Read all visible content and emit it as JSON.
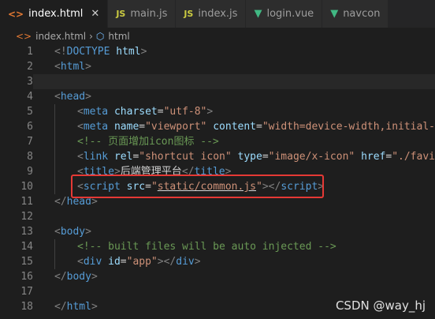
{
  "tabs": [
    {
      "label": "index.html",
      "icon": "html-file-icon",
      "active": true,
      "close": "✕"
    },
    {
      "label": "main.js",
      "icon": "js-file-icon",
      "badge": "JS"
    },
    {
      "label": "index.js",
      "icon": "js-file-icon",
      "badge": "JS"
    },
    {
      "label": "login.vue",
      "icon": "vue-file-icon"
    },
    {
      "label": "navcon",
      "icon": "vue-file-icon"
    }
  ],
  "breadcrumb": {
    "file": "index.html",
    "node": "html"
  },
  "lines": [
    {
      "num": "1",
      "parts": [
        [
          "br",
          "<!"
        ],
        [
          "tag",
          "DOCTYPE"
        ],
        [
          "txt",
          " "
        ],
        [
          "attr",
          "html"
        ],
        [
          "br",
          ">"
        ]
      ]
    },
    {
      "num": "2",
      "parts": [
        [
          "br",
          "<"
        ],
        [
          "tag",
          "html"
        ],
        [
          "br",
          ">"
        ]
      ]
    },
    {
      "num": "3",
      "parts": [],
      "current": true
    },
    {
      "num": "4",
      "parts": [
        [
          "br",
          "<"
        ],
        [
          "tag",
          "head"
        ],
        [
          "br",
          ">"
        ]
      ]
    },
    {
      "num": "5",
      "indent": 1,
      "parts": [
        [
          "br",
          "<"
        ],
        [
          "tag",
          "meta"
        ],
        [
          "txt",
          " "
        ],
        [
          "attr",
          "charset"
        ],
        [
          "txt",
          "="
        ],
        [
          "str",
          "\"utf-8\""
        ],
        [
          "br",
          ">"
        ]
      ]
    },
    {
      "num": "6",
      "indent": 1,
      "parts": [
        [
          "br",
          "<"
        ],
        [
          "tag",
          "meta"
        ],
        [
          "txt",
          " "
        ],
        [
          "attr",
          "name"
        ],
        [
          "txt",
          "="
        ],
        [
          "str",
          "\"viewport\""
        ],
        [
          "txt",
          " "
        ],
        [
          "attr",
          "content"
        ],
        [
          "txt",
          "="
        ],
        [
          "str",
          "\"width=device-width,initial-s"
        ]
      ]
    },
    {
      "num": "7",
      "indent": 1,
      "parts": [
        [
          "cm",
          "<!-- 页面增加icon图标 -->"
        ]
      ]
    },
    {
      "num": "8",
      "indent": 1,
      "parts": [
        [
          "br",
          "<"
        ],
        [
          "tag",
          "link"
        ],
        [
          "txt",
          " "
        ],
        [
          "attr",
          "rel"
        ],
        [
          "txt",
          "="
        ],
        [
          "str",
          "\"shortcut icon\""
        ],
        [
          "txt",
          " "
        ],
        [
          "attr",
          "type"
        ],
        [
          "txt",
          "="
        ],
        [
          "str",
          "\"image/x-icon\""
        ],
        [
          "txt",
          " "
        ],
        [
          "attr",
          "href"
        ],
        [
          "txt",
          "="
        ],
        [
          "str",
          "\"./favic"
        ]
      ]
    },
    {
      "num": "9",
      "indent": 1,
      "parts": [
        [
          "br",
          "<"
        ],
        [
          "tag",
          "title"
        ],
        [
          "br",
          ">"
        ],
        [
          "txt",
          "后端管理平台"
        ],
        [
          "br",
          "</"
        ],
        [
          "tag",
          "title"
        ],
        [
          "br",
          ">"
        ]
      ]
    },
    {
      "num": "10",
      "indent": 1,
      "parts": [
        [
          "br",
          "<"
        ],
        [
          "tag",
          "script"
        ],
        [
          "txt",
          " "
        ],
        [
          "attr",
          "src"
        ],
        [
          "txt",
          "="
        ],
        [
          "str",
          "\""
        ],
        [
          "str ul",
          "static/common.js"
        ],
        [
          "str",
          "\""
        ],
        [
          "br",
          ">"
        ],
        [
          "br",
          "</"
        ],
        [
          "tag",
          "script"
        ],
        [
          "br",
          ">"
        ]
      ]
    },
    {
      "num": "11",
      "parts": [
        [
          "br",
          "</"
        ],
        [
          "tag",
          "head"
        ],
        [
          "br",
          ">"
        ]
      ]
    },
    {
      "num": "12",
      "parts": []
    },
    {
      "num": "13",
      "parts": [
        [
          "br",
          "<"
        ],
        [
          "tag",
          "body"
        ],
        [
          "br",
          ">"
        ]
      ]
    },
    {
      "num": "14",
      "indent": 1,
      "parts": [
        [
          "cm",
          "<!-- built files will be auto injected -->"
        ]
      ]
    },
    {
      "num": "15",
      "indent": 1,
      "parts": [
        [
          "br",
          "<"
        ],
        [
          "tag",
          "div"
        ],
        [
          "txt",
          " "
        ],
        [
          "attr",
          "id"
        ],
        [
          "txt",
          "="
        ],
        [
          "str",
          "\"app\""
        ],
        [
          "br",
          ">"
        ],
        [
          "br",
          "</"
        ],
        [
          "tag",
          "div"
        ],
        [
          "br",
          ">"
        ]
      ]
    },
    {
      "num": "16",
      "parts": [
        [
          "br",
          "</"
        ],
        [
          "tag",
          "body"
        ],
        [
          "br",
          ">"
        ]
      ]
    },
    {
      "num": "17",
      "parts": []
    },
    {
      "num": "18",
      "parts": [
        [
          "br",
          "</"
        ],
        [
          "tag",
          "html"
        ],
        [
          "br",
          ">"
        ]
      ]
    }
  ],
  "watermark": "CSDN @way_hj"
}
